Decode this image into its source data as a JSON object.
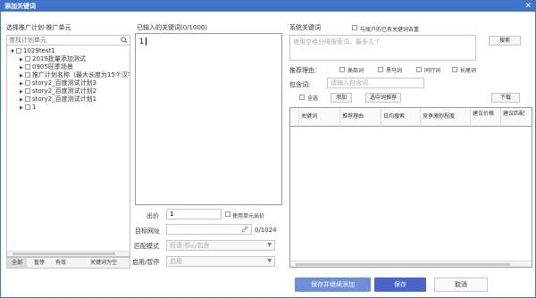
{
  "window": {
    "title": "添加关键词",
    "close": "✕"
  },
  "left": {
    "heading": "选择推广计划-推广单元",
    "search_placeholder": "查找计划单元",
    "tree": [
      {
        "label": "1029test1",
        "level": 0,
        "expanded": true
      },
      {
        "label": "2019批量添加测试",
        "level": 1
      },
      {
        "label": "0905旺季场景",
        "level": 1
      },
      {
        "label": "推广计划名称（最大长度为15个汉字",
        "level": 1
      },
      {
        "label": "story2_百度测试计划3",
        "level": 1
      },
      {
        "label": "story2_百度测试计划2",
        "level": 1
      },
      {
        "label": "story2_百度测试计划1",
        "level": 1
      },
      {
        "label": "1",
        "level": 1
      }
    ],
    "tabs": [
      "全部",
      "暂停",
      "有效",
      "关键词为空"
    ]
  },
  "middle": {
    "heading": "已输入的关键词(0/1000)",
    "line_number": "1",
    "bid_label": "出价",
    "bid_value": "1",
    "use_unit_bid": "使用单元出价",
    "url_label": "目标网址",
    "url_count": "0/1024",
    "match_label": "匹配模式",
    "match_value": "短语-核心包含",
    "status_label": "启用/暂停",
    "status_value": "启用"
  },
  "right": {
    "heading": "系统关键词",
    "dedupe": "与账户的已有关键词去重",
    "seed_placeholder": "使用空格分隔搜索词，最多五个",
    "search_button": "搜索",
    "reason_label": "推荐理由：",
    "reasons": [
      "高商词",
      "黑马词",
      "同行词",
      "长尾词"
    ],
    "contains_label": "包含词:",
    "contains_placeholder": "请输入包含词",
    "select_all": "全选",
    "add_button": "添加",
    "add_selected_button": "选中词推荐",
    "download_button": "下载",
    "columns": [
      "关键词",
      "推荐理由",
      "日均搜索",
      "竞争激烈程度",
      "建议价格",
      "建议匹配"
    ]
  },
  "footer": {
    "save_continue": "保存并继续添加",
    "save": "保存",
    "cancel": "取消"
  },
  "colors": {
    "title_bar": "#3f74c8",
    "primary": "#6c8fd8",
    "save": "#4a64c8"
  }
}
